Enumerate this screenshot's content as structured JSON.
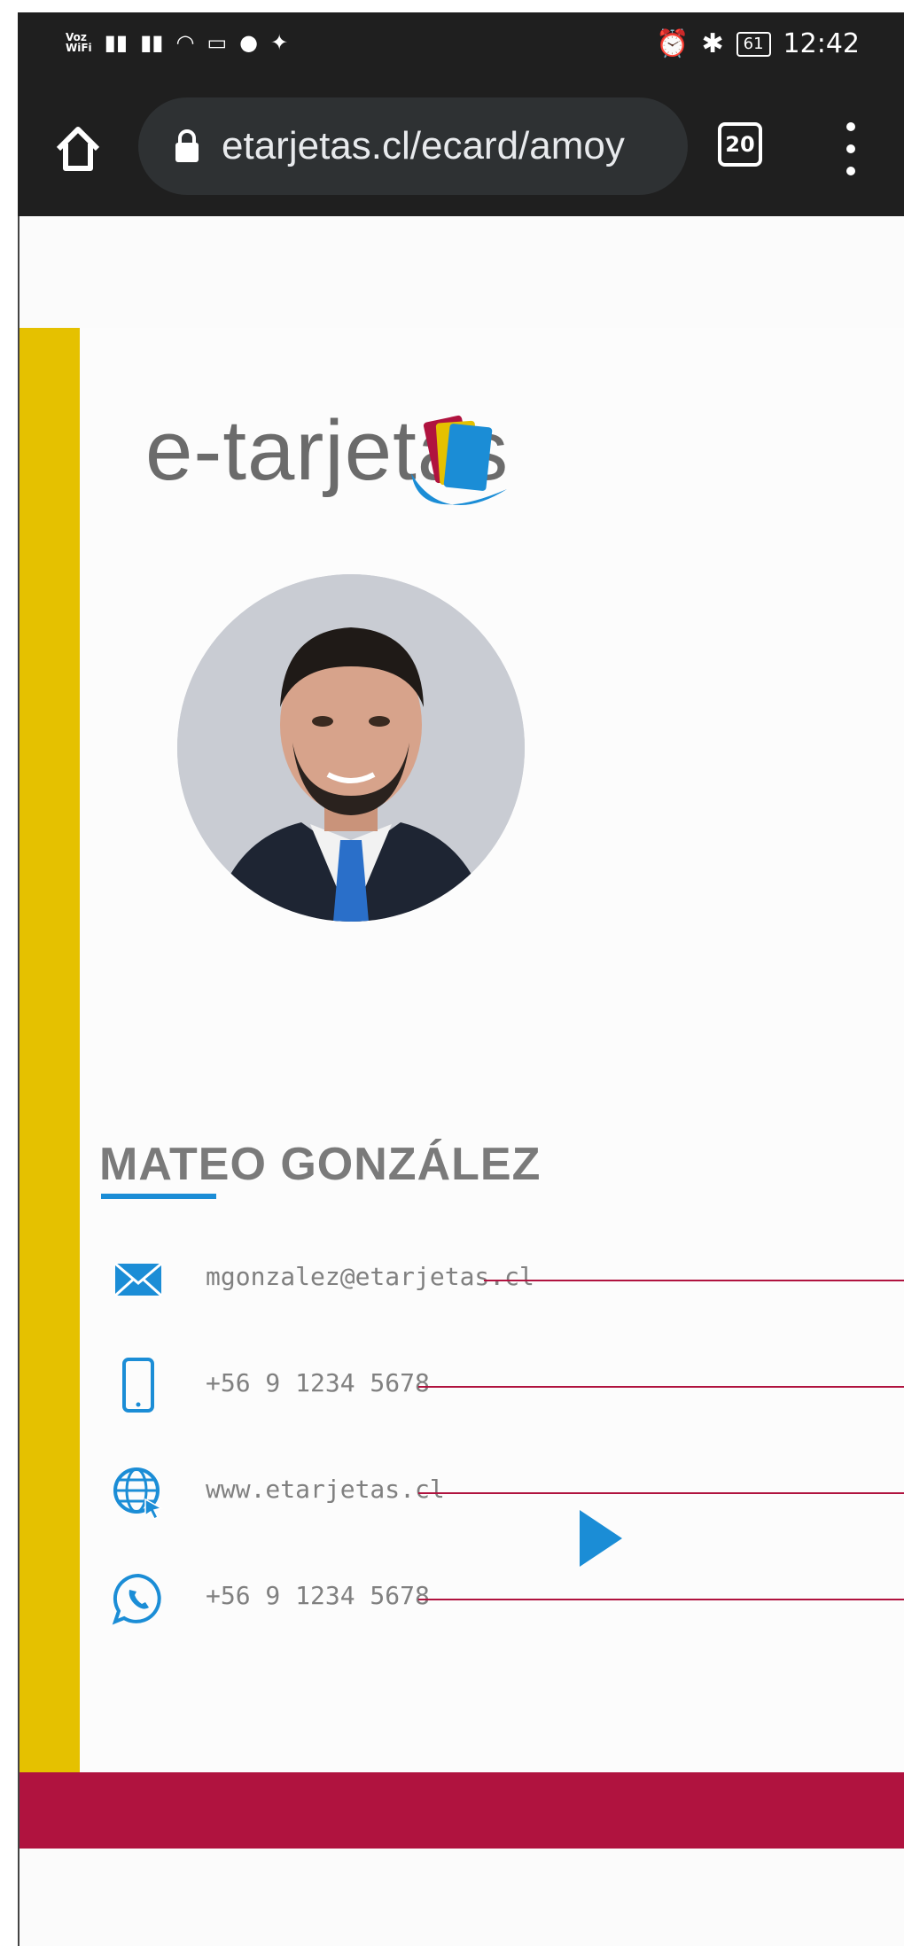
{
  "status_bar": {
    "voz_label": "Voz",
    "wifi_label": "WiFi",
    "battery": "61",
    "time": "12:42"
  },
  "browser": {
    "url": "etarjetas.cl/ecard/amoy",
    "tab_count": "20"
  },
  "card": {
    "logo_text": "e-tarjetas",
    "name": "MATEO GONZÁLEZ",
    "contacts": [
      {
        "icon": "email-icon",
        "value": "mgonzalez@etarjetas.cl"
      },
      {
        "icon": "phone-icon",
        "value": "+56 9 1234 5678"
      },
      {
        "icon": "web-icon",
        "value": "www.etarjetas.cl"
      },
      {
        "icon": "whatsapp-icon",
        "value": "+56 9 1234 5678"
      }
    ],
    "colors": {
      "accent_blue": "#1b8dd6",
      "yellow": "#e5c100",
      "crimson": "#b0133f"
    }
  }
}
